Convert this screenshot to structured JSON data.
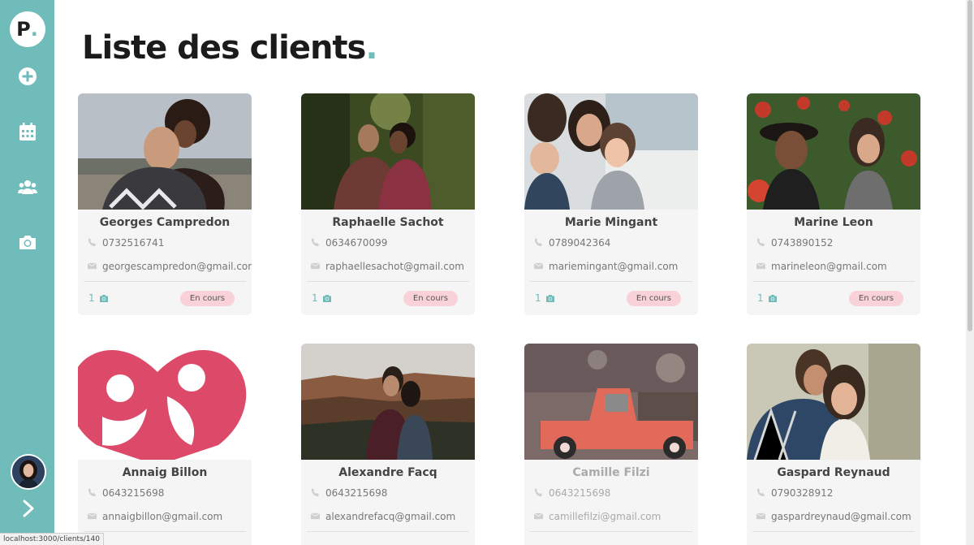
{
  "sidebar": {
    "logo_letter": "P",
    "logo_dot": ".",
    "nav": [
      {
        "icon": "plus-circle-icon"
      },
      {
        "icon": "calendar-icon"
      },
      {
        "icon": "users-icon"
      },
      {
        "icon": "camera-icon"
      }
    ],
    "avatar": "user-avatar",
    "expand_icon": "chevron-right-icon"
  },
  "page": {
    "title": "Liste des clients",
    "title_dot": "."
  },
  "colors": {
    "accent": "#6fbcba",
    "badge_bg": "#f8d1d9",
    "card_bg": "#f5f5f5"
  },
  "clients": [
    {
      "name": "Georges Campredon",
      "phone": "0732516741",
      "email": "georgescampredon@gmail.com",
      "photos": "1",
      "status": "En cours"
    },
    {
      "name": "Raphaelle Sachot",
      "phone": "0634670099",
      "email": "raphaellesachot@gmail.com",
      "photos": "1",
      "status": "En cours"
    },
    {
      "name": "Marie Mingant",
      "phone": "0789042364",
      "email": "mariemingant@gmail.com",
      "photos": "1",
      "status": "En cours"
    },
    {
      "name": "Marine Leon",
      "phone": "0743890152",
      "email": "marineleon@gmail.com",
      "photos": "1",
      "status": "En cours"
    },
    {
      "name": "Annaig Billon",
      "phone": "0643215698",
      "email": "annaigbillon@gmail.com",
      "photos": "",
      "status": ""
    },
    {
      "name": "Alexandre Facq",
      "phone": "0643215698",
      "email": "alexandrefacq@gmail.com",
      "photos": "",
      "status": ""
    },
    {
      "name": "Camille Filzi",
      "phone": "0643215698",
      "email": "camillefilzi@gmail.com",
      "photos": "",
      "status": ""
    },
    {
      "name": "Gaspard Reynaud",
      "phone": "0790328912",
      "email": "gaspardreynaud@gmail.com",
      "photos": "",
      "status": ""
    }
  ],
  "statusbar": {
    "url": "localhost:3000/clients/140"
  }
}
